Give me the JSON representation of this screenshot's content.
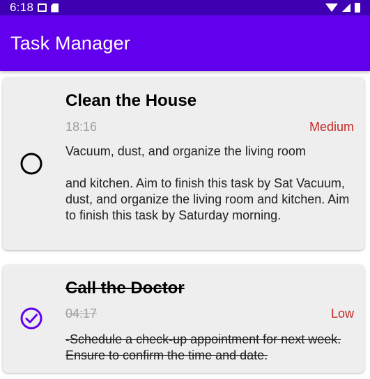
{
  "status_bar": {
    "time": "6:18"
  },
  "app_bar": {
    "title": "Task Manager"
  },
  "colors": {
    "status_bar": "#3f00b4",
    "app_bar": "#6200ee",
    "priority": "#c62828",
    "check_done": "#6200ee",
    "card": "#eeeeee"
  },
  "tasks": [
    {
      "title": "Clean the House",
      "time": "18:16",
      "priority": "Medium",
      "description_line1": "Vacuum, dust, and organize the living room",
      "description_line2": " and kitchen. Aim to finish this task by Sat Vacuum, dust, and organize the living room and kitchen. Aim to finish this task by Saturday morning.",
      "completed": false,
      "check_icon": "circle-outline-icon"
    },
    {
      "title": "Call the Doctor",
      "time": "04:17",
      "priority": "Low",
      "description_line1": "-Schedule a check-up appointment for next week. Ensure to confirm the time and date.",
      "completed": true,
      "check_icon": "check-circle-icon"
    }
  ]
}
